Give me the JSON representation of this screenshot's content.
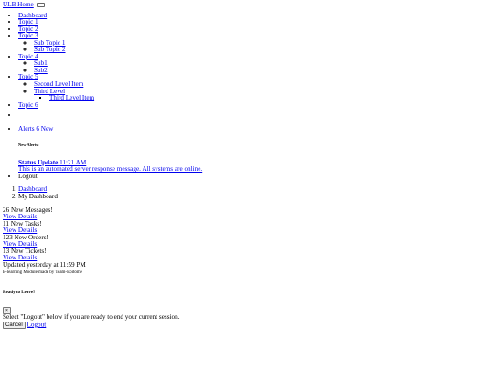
{
  "brand": {
    "label": "ULB Home"
  },
  "nav": {
    "items": [
      {
        "label": "Dashboard"
      },
      {
        "label": "Topic 1"
      },
      {
        "label": "Topic 2"
      },
      {
        "label": "Topic 3",
        "children": [
          "Sub Topic 1",
          "Sub Topic 2"
        ]
      },
      {
        "label": "Topic 4",
        "children": [
          "Sub1",
          "Sub2"
        ]
      },
      {
        "label": "Topic 5",
        "children": [
          "Second Level Item",
          "Third Level"
        ],
        "grandchild": "Third Level Item"
      },
      {
        "label": "Topic 6"
      }
    ]
  },
  "alerts": {
    "link_label": "Alerts 6 New",
    "header": "New Alerts:",
    "item": {
      "title": "Status Update",
      "time": "11:21 AM",
      "message": "This is an automated server response message. All systems are online."
    }
  },
  "logout_label": "Logout",
  "breadcrumb": [
    "Dashboard",
    "My Dashboard"
  ],
  "cards": [
    {
      "text": "26 New Messages!",
      "link": "View Details"
    },
    {
      "text": "11 New Tasks!",
      "link": "View Details"
    },
    {
      "text": "123 New Orders!",
      "link": "View Details"
    },
    {
      "text": "13 New Tickets!",
      "link": "View Details"
    }
  ],
  "updated": "Updated yesterday at 11:59 PM",
  "footer": "E-learning Module made by Team-Epitome",
  "modal": {
    "title": "Ready to Leave?",
    "close": "×",
    "body": "Select \"Logout\" below if you are ready to end your current session.",
    "cancel": "Cancel",
    "logout": "Logout"
  }
}
